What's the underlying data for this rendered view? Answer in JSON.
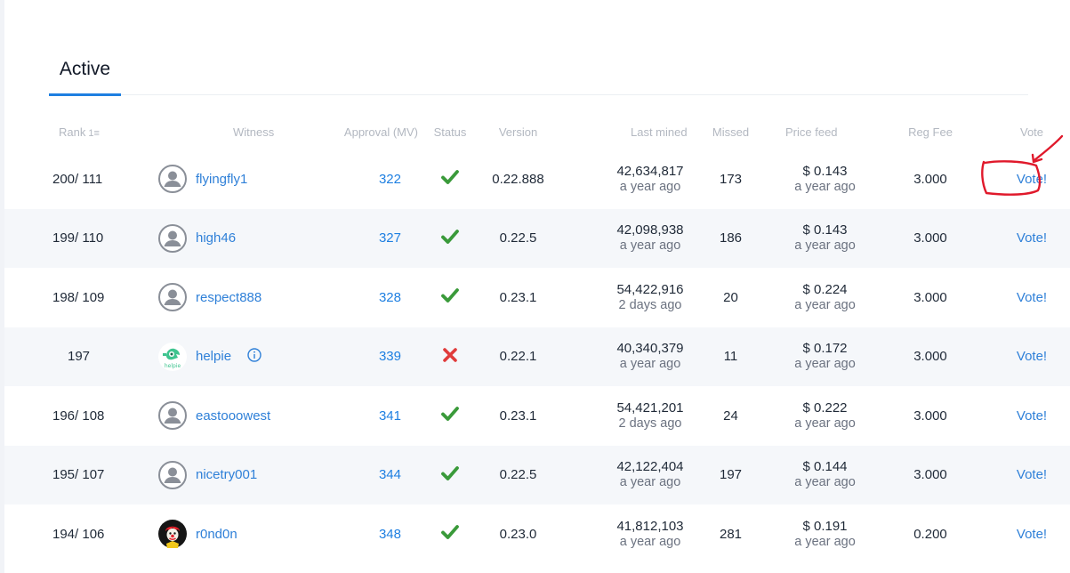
{
  "tabs": [
    {
      "label": "Active",
      "active": true
    }
  ],
  "table": {
    "headers": {
      "rank": "Rank",
      "rank_sort_icon": "sort-numeric-ascending-icon",
      "witness": "Witness",
      "approval": "Approval (MV)",
      "status": "Status",
      "version": "Version",
      "last_mined": "Last mined",
      "missed": "Missed",
      "price_feed": "Price feed",
      "reg_fee": "Reg Fee",
      "vote": "Vote"
    },
    "rows": [
      {
        "rank": "200/ 111",
        "witness": "flyingfly1",
        "avatar": "default-user-icon",
        "approval": "322",
        "status": "active",
        "version": "0.22.888",
        "last_mined_block": "42,634,817",
        "last_mined_time": "a year ago",
        "missed": "173",
        "price": "$ 0.143",
        "price_time": "a year ago",
        "reg_fee": "3.000",
        "vote": "Vote!"
      },
      {
        "rank": "199/ 110",
        "witness": "high46",
        "avatar": "default-user-icon",
        "approval": "327",
        "status": "active",
        "version": "0.22.5",
        "last_mined_block": "42,098,938",
        "last_mined_time": "a year ago",
        "missed": "186",
        "price": "$ 0.143",
        "price_time": "a year ago",
        "reg_fee": "3.000",
        "vote": "Vote!"
      },
      {
        "rank": "198/ 109",
        "witness": "respect888",
        "avatar": "default-user-icon",
        "approval": "328",
        "status": "active",
        "version": "0.23.1",
        "last_mined_block": "54,422,916",
        "last_mined_time": "2 days ago",
        "missed": "20",
        "price": "$ 0.224",
        "price_time": "a year ago",
        "reg_fee": "3.000",
        "vote": "Vote!"
      },
      {
        "rank": "197",
        "witness": "helpie",
        "avatar": "helpie-logo",
        "info_icon": "info-circle-icon",
        "approval": "339",
        "status": "disabled",
        "version": "0.22.1",
        "last_mined_block": "40,340,379",
        "last_mined_time": "a year ago",
        "missed": "11",
        "price": "$ 0.172",
        "price_time": "a year ago",
        "reg_fee": "3.000",
        "vote": "Vote!"
      },
      {
        "rank": "196/ 108",
        "witness": "eastooowest",
        "avatar": "default-user-icon",
        "approval": "341",
        "status": "active",
        "version": "0.23.1",
        "last_mined_block": "54,421,201",
        "last_mined_time": "2 days ago",
        "missed": "24",
        "price": "$ 0.222",
        "price_time": "a year ago",
        "reg_fee": "3.000",
        "vote": "Vote!"
      },
      {
        "rank": "195/ 107",
        "witness": "nicetry001",
        "avatar": "default-user-icon",
        "approval": "344",
        "status": "active",
        "version": "0.22.5",
        "last_mined_block": "42,122,404",
        "last_mined_time": "a year ago",
        "missed": "197",
        "price": "$ 0.144",
        "price_time": "a year ago",
        "reg_fee": "3.000",
        "vote": "Vote!"
      },
      {
        "rank": "194/ 106",
        "witness": "r0nd0n",
        "avatar": "clown-avatar",
        "approval": "348",
        "status": "active",
        "version": "0.23.0",
        "last_mined_block": "41,812,103",
        "last_mined_time": "a year ago",
        "missed": "281",
        "price": "$ 0.191",
        "price_time": "a year ago",
        "reg_fee": "0.200",
        "vote": "Vote!"
      }
    ]
  },
  "colors": {
    "accent": "#1e7fe1",
    "link": "#2f80d8",
    "status_ok": "#3a9a3a",
    "status_bad": "#e03b3b",
    "annotation": "#e0192b",
    "stripe": "#f5f7fa"
  },
  "annotation": {
    "shape": "hand-drawn-circle-with-arrow",
    "target": "first-row-vote-button"
  }
}
